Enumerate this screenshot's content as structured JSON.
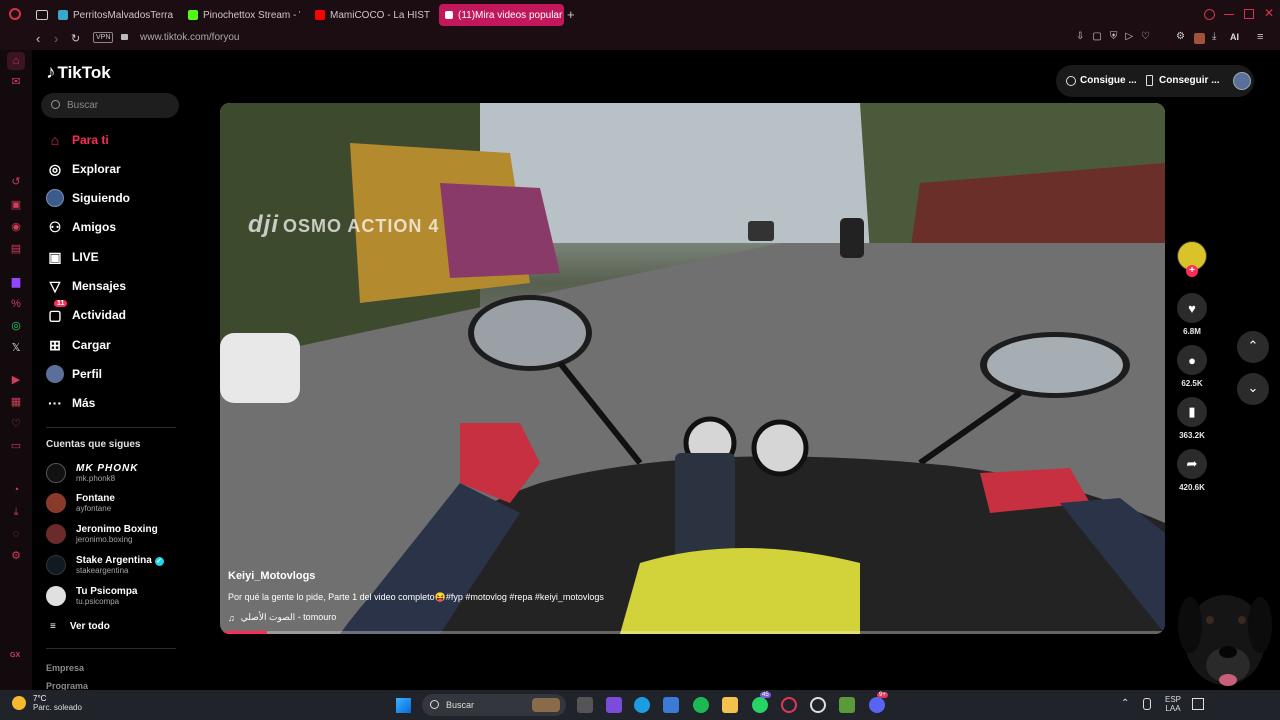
{
  "browser": {
    "tabs": [
      {
        "title": "PerritosMalvadosTerraria",
        "color": "#3aa6c9"
      },
      {
        "title": "Pinochettox Stream - Watc",
        "color": "#53fc18"
      },
      {
        "title": "MamiCOCO - La HISTORIA",
        "color": "#ff0000"
      },
      {
        "title": "(11)Mira videos popular",
        "color": "#ffffff"
      }
    ],
    "url": "www.tiktok.com/foryou",
    "vpn": "VPN",
    "ai_label": "AI"
  },
  "tiktok": {
    "logo": "TikTok",
    "search_placeholder": "Buscar",
    "nav": [
      {
        "label": "Para ti",
        "icon": "home-icon",
        "active": true
      },
      {
        "label": "Explorar",
        "icon": "compass-icon"
      },
      {
        "label": "Siguiendo",
        "icon": "following-icon"
      },
      {
        "label": "Amigos",
        "icon": "friends-icon"
      },
      {
        "label": "LIVE",
        "icon": "live-icon"
      },
      {
        "label": "Mensajes",
        "icon": "messages-icon"
      },
      {
        "label": "Actividad",
        "icon": "activity-icon",
        "badge": "11"
      },
      {
        "label": "Cargar",
        "icon": "upload-icon"
      },
      {
        "label": "Perfil",
        "icon": "profile-icon"
      },
      {
        "label": "Más",
        "icon": "more-icon"
      }
    ],
    "following_title": "Cuentas que sigues",
    "following": [
      {
        "name": "MK PHONK",
        "handle": "mk.phonk8"
      },
      {
        "name": "Fontane",
        "handle": "ayfontane"
      },
      {
        "name": "Jeronimo Boxing",
        "handle": "jeronimo.boxing"
      },
      {
        "name": "Stake Argentina",
        "handle": "stakeargentina",
        "verified": true
      },
      {
        "name": "Tu Psicompa",
        "handle": "tu.psicompa"
      }
    ],
    "see_all": "Ver todo",
    "footer_links": [
      "Empresa",
      "Programa"
    ],
    "header_buttons": [
      "Consigue ...",
      "Conseguir ..."
    ]
  },
  "video": {
    "author": "Keiyi_Motovlogs",
    "caption": "Por qué la gente lo pide, Parte 1 del video completo😝#fyp #motovlog #repa #keiyi_motovlogs",
    "sound": "الصوت الأصلي - tomouro",
    "watermark": "OSMO ACTION 4",
    "progress": 0.05,
    "likes": "6.8M",
    "comments": "62.5K",
    "saves": "363.2K",
    "shares": "420.6K"
  },
  "taskbar": {
    "weather_temp": "7°C",
    "weather_desc": "Parc. soleado",
    "search": "Buscar",
    "lang": "ESP",
    "lang2": "LAA",
    "badges": [
      "45",
      "9+"
    ]
  }
}
